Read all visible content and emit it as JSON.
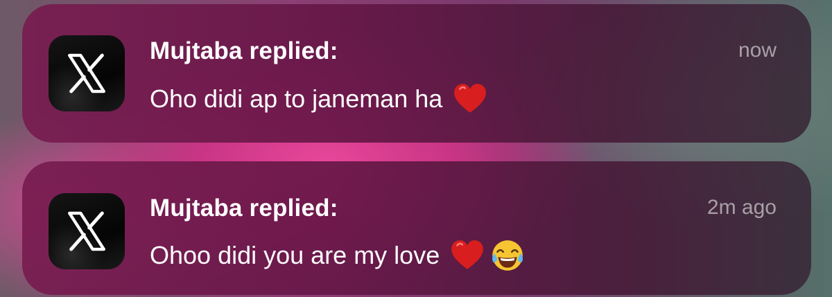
{
  "notifications": [
    {
      "app_icon": "x-logo-icon",
      "title": "Mujtaba replied:",
      "time": "now",
      "message": "Oho didi ap to janeman ha",
      "emojis": [
        "red-heart-emoji"
      ]
    },
    {
      "app_icon": "x-logo-icon",
      "title": "Mujtaba replied:",
      "time": "2m ago",
      "message": "Ohoo didi you are my love",
      "emojis": [
        "red-heart-emoji",
        "face-with-tears-of-joy-emoji"
      ]
    }
  ],
  "colors": {
    "card": "#6e1c4f",
    "text": "#ffffff",
    "time_text": "#b8a6b2",
    "heart": "#d81e1e",
    "icon_bg": "#0a0a0a"
  }
}
